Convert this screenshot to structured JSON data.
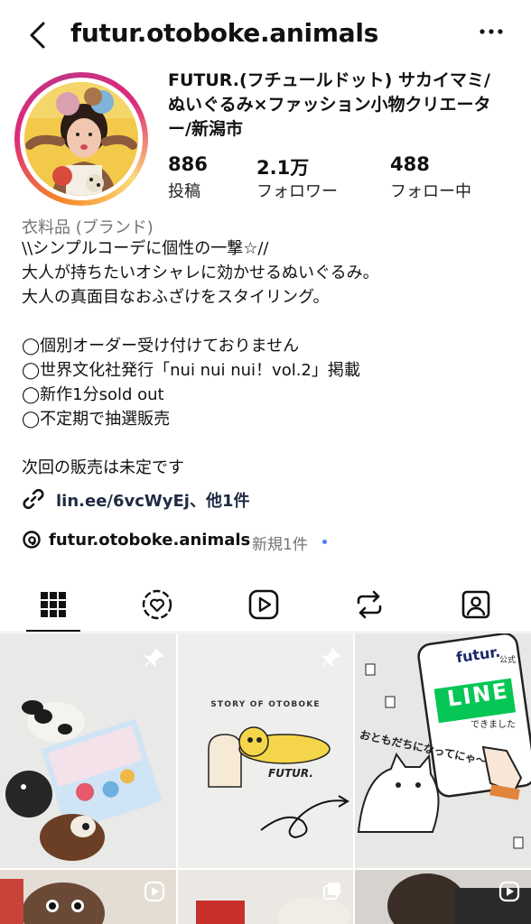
{
  "header": {
    "username": "futur.otoboke.animals",
    "back_icon": "chevron-left-icon",
    "more_icon": "more-horizontal-icon"
  },
  "profile": {
    "display_name_line1": "FUTUR.(フチュールドット) サカイマミ/",
    "display_name_line2": "ぬいぐるみ×ファッション小物クリエータ",
    "display_name_line3": "ー/新潟市",
    "stats": [
      {
        "value": "886",
        "label": "投稿"
      },
      {
        "value": "2.1万",
        "label": "フォロワー"
      },
      {
        "value": "488",
        "label": "フォロー中"
      }
    ],
    "category": "衣料品 (ブランド)",
    "bio": "\\\\シンプルコーデに個性の一撃☆//\n大人が持ちたいオシャレに効かせるぬいぐるみ。\n大人の真面目なおふざけをスタイリング。\n\n◯個別オーダー受け付けておりません\n◯世界文化社発行「nui nui nui！vol.2」掲載\n◯新作1分sold out\n◯不定期で抽選販売\n\n次回の販売は未定です",
    "link": "lin.ee/6vcWyEj、他1件",
    "threads_handle": "futur.otoboke.animals",
    "threads_new": "新規1件"
  },
  "tabs": [
    {
      "name": "grid-icon",
      "active": true
    },
    {
      "name": "reels-profile-icon",
      "active": false
    },
    {
      "name": "play-icon",
      "active": false
    },
    {
      "name": "reposts-icon",
      "active": false
    },
    {
      "name": "tagged-icon",
      "active": false
    }
  ],
  "posts": {
    "tile2": {
      "story_label": "STORY OF OTOBOKE",
      "logo": "FUTUR."
    },
    "tile3": {
      "brand": "futur.",
      "official": "公式",
      "line": "LINE",
      "dekimashita": "できました",
      "friend_text": "おともだちになってにゃ〜"
    }
  },
  "colors": {
    "accent": "#4f7cff",
    "line_green": "#06c755",
    "muted": "#737373"
  }
}
